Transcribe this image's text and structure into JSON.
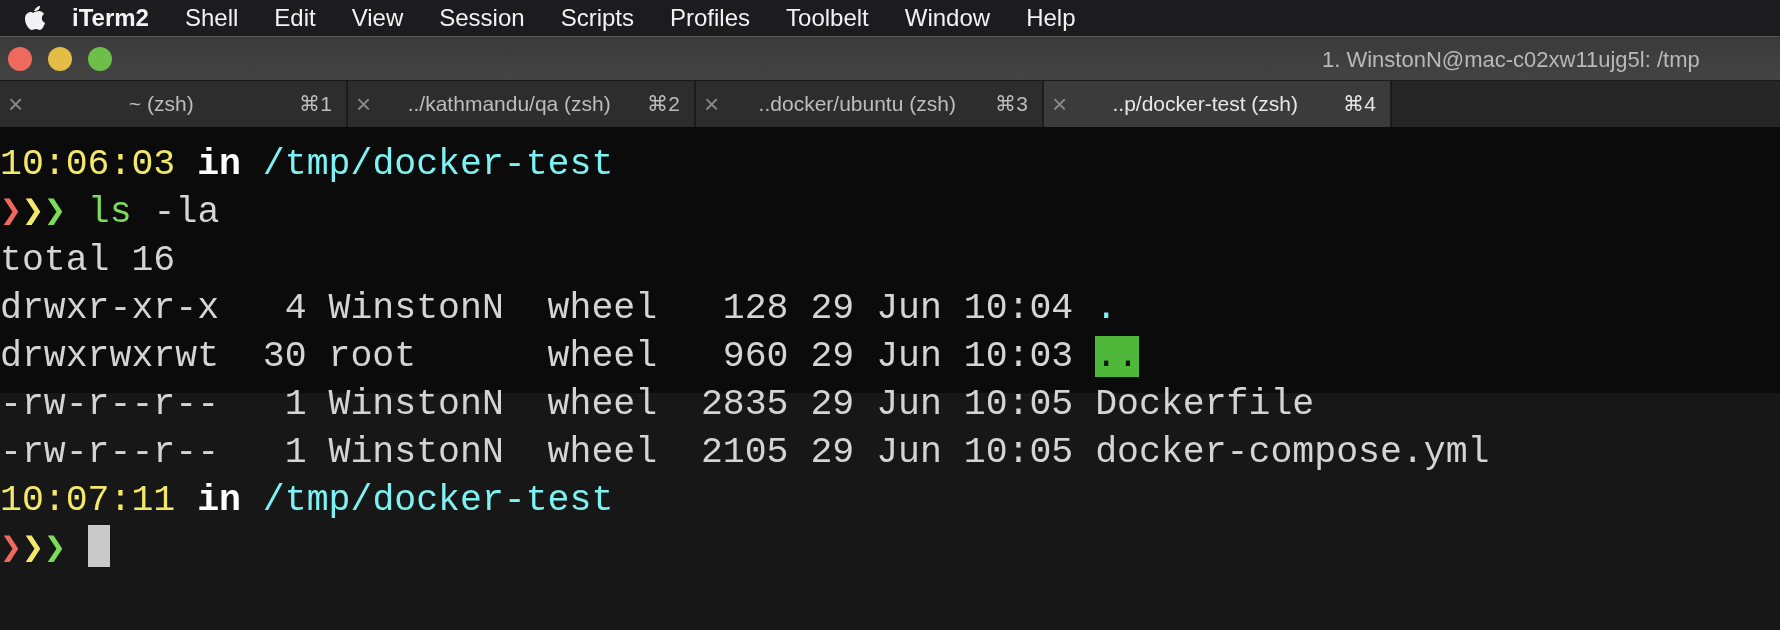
{
  "menu_bar": {
    "items": [
      {
        "label": "iTerm2",
        "kind": "app"
      },
      {
        "label": "Shell",
        "kind": "menu"
      },
      {
        "label": "Edit",
        "kind": "menu"
      },
      {
        "label": "View",
        "kind": "menu"
      },
      {
        "label": "Session",
        "kind": "menu"
      },
      {
        "label": "Scripts",
        "kind": "menu"
      },
      {
        "label": "Profiles",
        "kind": "menu"
      },
      {
        "label": "Toolbelt",
        "kind": "menu"
      },
      {
        "label": "Window",
        "kind": "menu"
      },
      {
        "label": "Help",
        "kind": "menu"
      }
    ]
  },
  "window": {
    "title": "1. WinstonN@mac-c02xw11ujg5l: /tmp"
  },
  "tabs": [
    {
      "close": "×",
      "label": "~ (zsh)",
      "shortcut": "⌘1",
      "selected": false
    },
    {
      "close": "×",
      "label": "../kathmandu/qa (zsh)",
      "shortcut": "⌘2",
      "selected": false
    },
    {
      "close": "×",
      "label": "..docker/ubuntu (zsh)",
      "shortcut": "⌘3",
      "selected": false
    },
    {
      "close": "×",
      "label": "..p/docker-test (zsh)",
      "shortcut": "⌘4",
      "selected": true
    }
  ],
  "terminal": {
    "lines": [
      {
        "kind": "header",
        "time": "10:06:03",
        "word": "in",
        "path": "/tmp/docker-test"
      },
      {
        "kind": "command",
        "prompt": "❯❯❯",
        "command": "ls",
        "args": "-la"
      },
      {
        "kind": "output",
        "text": "total 16"
      },
      {
        "kind": "listing",
        "text": "drwxr-xr-x   4 WinstonN  wheel   128 29 Jun 10:04",
        "name": ".",
        "color": "#7ef2f2"
      },
      {
        "kind": "listing",
        "text": "drwxrwxrwt  30 root      wheel   960 29 Jun 10:03",
        "name": "..",
        "color": "#4fb83a",
        "highlighted": true
      },
      {
        "kind": "listing",
        "text": "-rw-r--r--   1 WinstonN  wheel  2835 29 Jun 10:05",
        "name": "Dockerfile",
        "color": "#d4d4d4"
      },
      {
        "kind": "listing",
        "text": "-rw-r--r--   1 WinstonN  wheel  2105 29 Jun 10:05",
        "name": "docker-compose.yml",
        "color": "#d4d4d4"
      },
      {
        "kind": "header",
        "time": "10:07:11",
        "word": "in",
        "path": "/tmp/docker-test"
      },
      {
        "kind": "command",
        "prompt": "❯❯❯",
        "cursor": true
      }
    ]
  }
}
